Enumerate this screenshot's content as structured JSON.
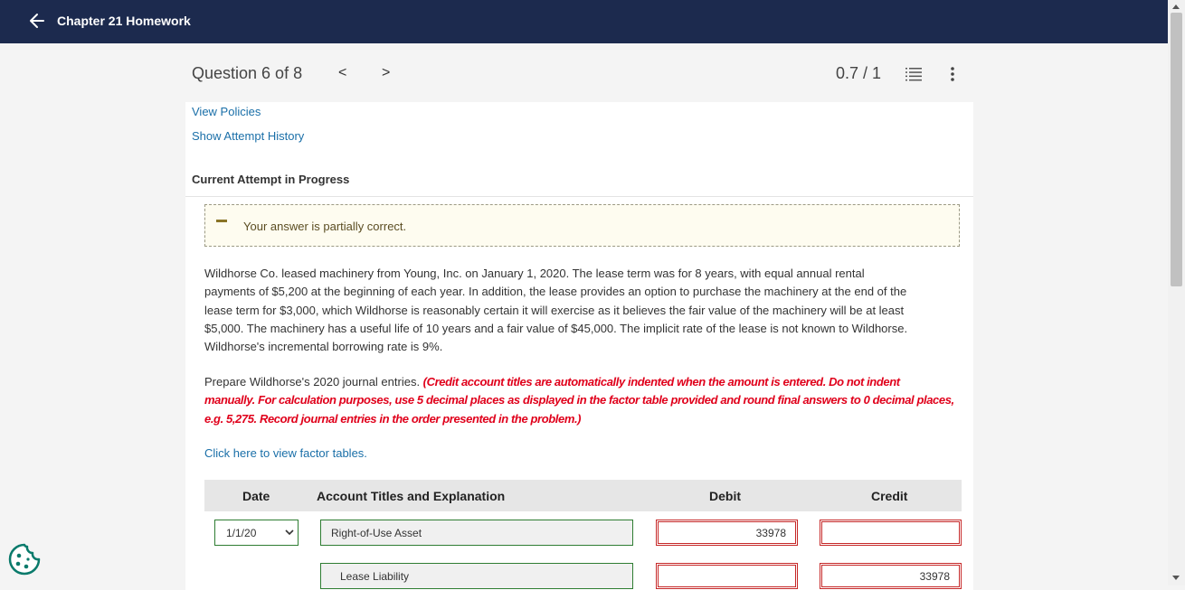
{
  "topbar": {
    "title": "Chapter 21 Homework"
  },
  "question": {
    "label": "Question 6 of 8",
    "prev": "<",
    "next": ">",
    "score": "0.7 / 1"
  },
  "links": {
    "view_policies": "View Policies",
    "show_attempt_history": "Show Attempt History",
    "factor_tables": "Click here to view factor tables."
  },
  "attempt_title": "Current Attempt in Progress",
  "feedback": {
    "text": "Your answer is partially correct."
  },
  "problem": {
    "line1": "Wildhorse Co. leased machinery from Young, Inc. on January 1, 2020. The lease term was for 8 years, with equal annual rental",
    "line2": "payments of $5,200 at the beginning of each year. In addition, the lease provides an option to purchase the machinery at the end of the",
    "line3": "lease term for $3,000, which Wildhorse is reasonably certain it will exercise as it believes the fair value of the machinery will be at least",
    "line4": "$5,000. The machinery has a useful life of 10 years and a fair value of $45,000. The implicit rate of the lease is not known to Wildhorse.",
    "line5": "Wildhorse's incremental borrowing rate is 9%."
  },
  "instructions": {
    "lead": "Prepare Wildhorse's 2020 journal entries. ",
    "red1": "(Credit account titles are automatically indented when the amount is entered. Do not indent",
    "red2": "manually. For calculation purposes, use 5 decimal places as displayed in the factor table provided and round final answers to 0 decimal places,",
    "red3": "e.g. 5,275. Record journal entries in the order presented in the problem.)"
  },
  "table": {
    "headers": {
      "date": "Date",
      "account": "Account Titles and Explanation",
      "debit": "Debit",
      "credit": "Credit"
    },
    "rows": [
      {
        "date": "1/1/20",
        "account": "Right-of-Use Asset",
        "debit": "33978",
        "credit": ""
      },
      {
        "date": "",
        "account": "Lease Liability",
        "debit": "",
        "credit": "33978"
      }
    ]
  },
  "icons": {
    "back": "arrow-left-icon",
    "list": "list-icon",
    "more": "more-vertical-icon",
    "cookie": "cookie-icon",
    "feedback": "minus-icon"
  },
  "colors": {
    "topbar": "#1c2a4e",
    "link": "#1a6fa8",
    "instruction_red": "#e0001b",
    "correct_border": "#2e7d32",
    "incorrect_border": "#c62828",
    "feedback_bg": "#fefcf0"
  }
}
